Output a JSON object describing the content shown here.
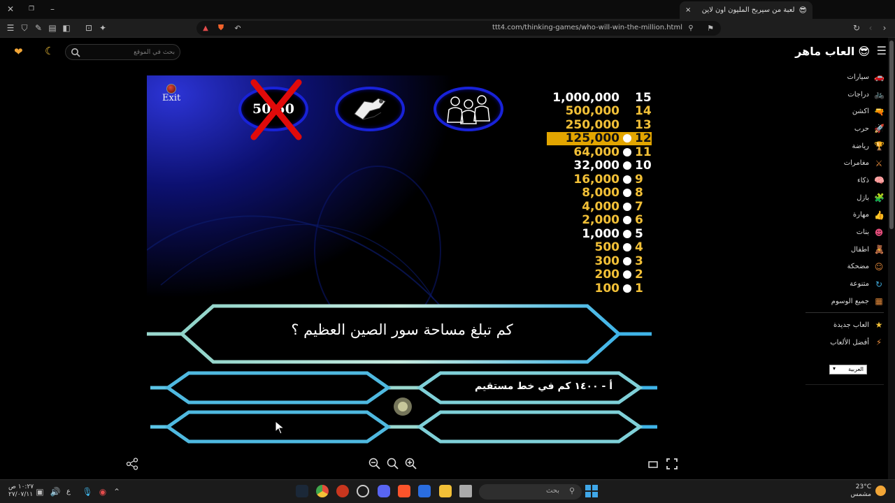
{
  "browser": {
    "tab_title": "لعبة من سيربح المليون اون لاين",
    "url": "ttt4.com/thinking-games/who-will-win-the-million.html",
    "new_tab": "+",
    "close_tab": "×"
  },
  "site": {
    "logo": "العاب ماهر",
    "search_placeholder": "بحث في الموقع",
    "categories": [
      {
        "label": "سيارات",
        "icon": "car-icon",
        "glyph": "🚗",
        "color": "#3fa7d6"
      },
      {
        "label": "دراجات",
        "icon": "bike-icon",
        "glyph": "🚲",
        "color": "#e34c7a"
      },
      {
        "label": "اكشن",
        "icon": "gun-icon",
        "glyph": "🔫",
        "color": "#6bd13a"
      },
      {
        "label": "حرب",
        "icon": "rocket-icon",
        "glyph": "🚀",
        "color": "#e34c7a"
      },
      {
        "label": "رياضة",
        "icon": "trophy-icon",
        "glyph": "🏆",
        "color": "#e36c3a"
      },
      {
        "label": "مغامرات",
        "icon": "sword-icon",
        "glyph": "⚔",
        "color": "#e3893a"
      },
      {
        "label": "ذكاء",
        "icon": "brain-icon",
        "glyph": "🧠",
        "color": "#9b59e3"
      },
      {
        "label": "بازل",
        "icon": "puzzle-icon",
        "glyph": "🧩",
        "color": "#3f7bd6"
      },
      {
        "label": "مهارة",
        "icon": "thumb-icon",
        "glyph": "👍",
        "color": "#6bd13a"
      },
      {
        "label": "بنات",
        "icon": "face-icon",
        "glyph": "☻",
        "color": "#e34c7a"
      },
      {
        "label": "اطفال",
        "icon": "kid-icon",
        "glyph": "🧸",
        "color": "#3fd6b7"
      },
      {
        "label": "مضحكة",
        "icon": "smile-icon",
        "glyph": "☺",
        "color": "#e3893a"
      },
      {
        "label": "متنوعة",
        "icon": "shuffle-icon",
        "glyph": "↻",
        "color": "#3fa7d6"
      },
      {
        "label": "جميع الوسوم",
        "icon": "grid-icon",
        "glyph": "▦",
        "color": "#e3893a"
      }
    ],
    "extra": [
      {
        "label": "العاب جديدة",
        "icon": "star-icon",
        "glyph": "★",
        "color": "#f2c037"
      },
      {
        "label": "أفضل الألعاب",
        "icon": "bolt-icon",
        "glyph": "⚡",
        "color": "#e3893a"
      }
    ],
    "language": "العربية"
  },
  "game": {
    "exit_label": "Exit",
    "lifeline_5050": "50:50",
    "question": "كم تبلغ مساحة سور الصين العظيم ؟",
    "answer_a": "أ - ١٤٠٠ كم في خط مستقيم",
    "money_ladder": [
      {
        "level": "15",
        "amount": "1,000,000",
        "color": "#ffffff",
        "dot": false
      },
      {
        "level": "14",
        "amount": "500,000",
        "color": "#f2c037",
        "dot": false
      },
      {
        "level": "13",
        "amount": "250,000",
        "color": "#f2c037",
        "dot": false
      },
      {
        "level": "12",
        "amount": "125,000",
        "color": "#111111",
        "dot": true,
        "current": true
      },
      {
        "level": "11",
        "amount": "64,000",
        "color": "#f2c037",
        "dot": true
      },
      {
        "level": "10",
        "amount": "32,000",
        "color": "#ffffff",
        "dot": true
      },
      {
        "level": "9",
        "amount": "16,000",
        "color": "#f2c037",
        "dot": true
      },
      {
        "level": "8",
        "amount": "8,000",
        "color": "#f2c037",
        "dot": true
      },
      {
        "level": "7",
        "amount": "4,000",
        "color": "#f2c037",
        "dot": true
      },
      {
        "level": "6",
        "amount": "2,000",
        "color": "#f2c037",
        "dot": true
      },
      {
        "level": "5",
        "amount": "1,000",
        "color": "#ffffff",
        "dot": true
      },
      {
        "level": "4",
        "amount": "500",
        "color": "#f2c037",
        "dot": true
      },
      {
        "level": "3",
        "amount": "300",
        "color": "#f2c037",
        "dot": true
      },
      {
        "level": "2",
        "amount": "200",
        "color": "#f2c037",
        "dot": true
      },
      {
        "level": "1",
        "amount": "100",
        "color": "#f2c037",
        "dot": true
      }
    ]
  },
  "taskbar": {
    "search_placeholder": "بحث",
    "weather_temp": "23°C",
    "weather_desc": "مشمس",
    "time": "١٠:٢٧ ص",
    "date": "٢٧/٠٧/١١",
    "lang": "ع"
  }
}
